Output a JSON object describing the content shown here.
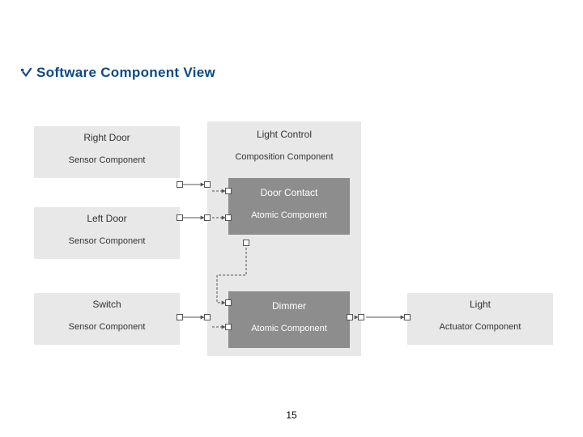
{
  "title": "Software Component View",
  "page_number": "15",
  "components": {
    "right_door": {
      "name": "Right Door",
      "type": "Sensor Component"
    },
    "left_door": {
      "name": "Left Door",
      "type": "Sensor Component"
    },
    "switch": {
      "name": "Switch",
      "type": "Sensor Component"
    },
    "light_control": {
      "name": "Light Control",
      "type": "Composition Component"
    },
    "door_contact": {
      "name": "Door Contact",
      "type": "Atomic Component"
    },
    "dimmer": {
      "name": "Dimmer",
      "type": "Atomic Component"
    },
    "light": {
      "name": "Light",
      "type": "Actuator Component"
    }
  },
  "icon_name": "check-bullet-icon"
}
